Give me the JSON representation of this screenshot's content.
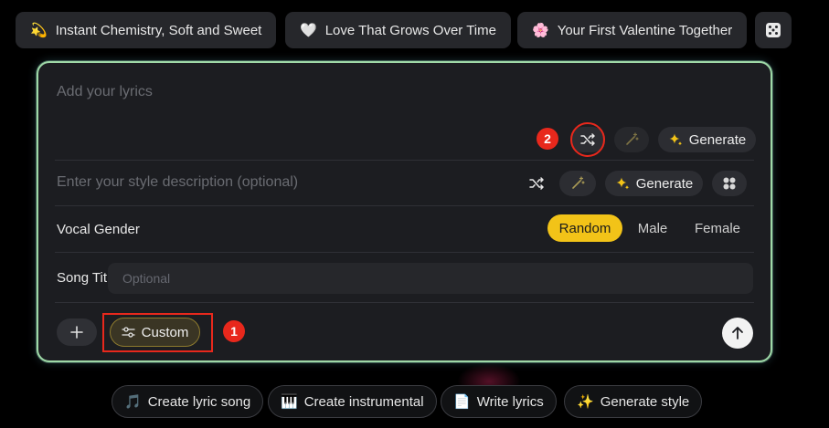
{
  "suggestions": [
    {
      "emoji": "💫",
      "label": "Instant Chemistry, Soft and Sweet"
    },
    {
      "emoji": "🤍",
      "label": "Love That Grows Over Time"
    },
    {
      "emoji": "🌸",
      "label": "Your First Valentine Together"
    }
  ],
  "dice_icon": "dice-icon",
  "lyrics": {
    "placeholder": "Add your lyrics",
    "generate_label": "Generate"
  },
  "style": {
    "placeholder": "Enter your style description (optional)",
    "generate_label": "Generate"
  },
  "vocal": {
    "label": "Vocal Gender",
    "options": [
      "Random",
      "Male",
      "Female"
    ],
    "selected": "Random"
  },
  "song_title": {
    "label": "Song Title",
    "placeholder": "Optional"
  },
  "custom_label": "Custom",
  "annotations": {
    "badge1": "1",
    "badge2": "2"
  },
  "bottom_actions": [
    {
      "emoji": "🎵",
      "label": "Create lyric song"
    },
    {
      "emoji": "🎹",
      "label": "Create instrumental"
    },
    {
      "emoji": "📄",
      "label": "Write lyrics"
    },
    {
      "emoji": "✨",
      "label": "Generate style"
    }
  ],
  "colors": {
    "accent": "#f2c318",
    "annotation": "#e8281c",
    "card_border": "#9fd9a7"
  }
}
